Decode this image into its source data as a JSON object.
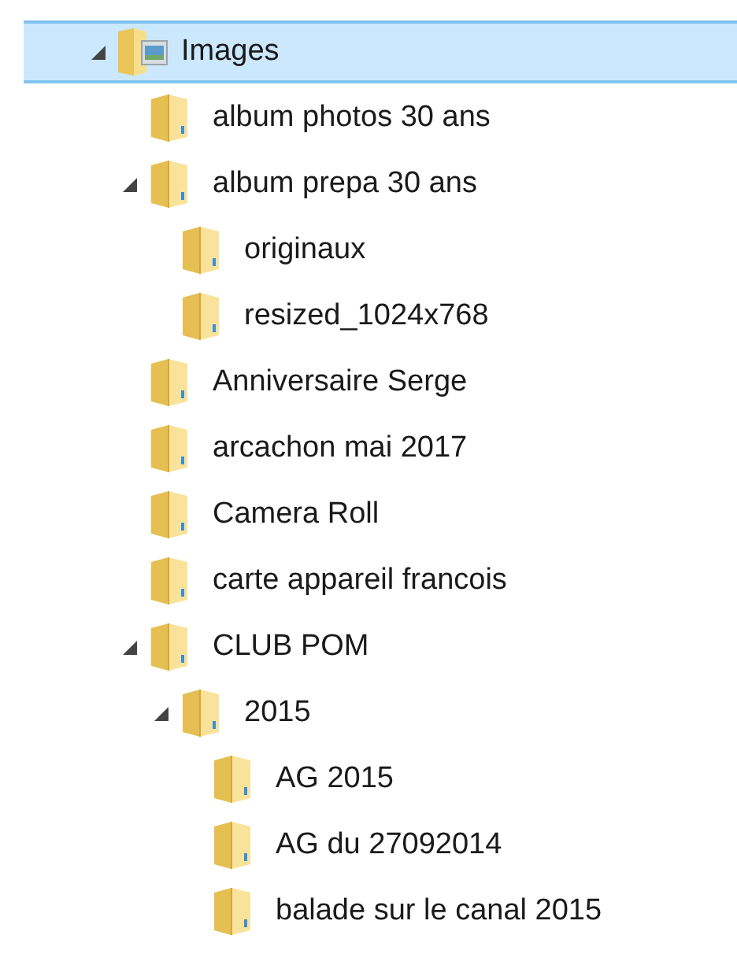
{
  "tree": [
    {
      "label": "Images",
      "kind": "library",
      "selected": true,
      "expanded": true,
      "children": [
        {
          "label": "album photos 30 ans",
          "kind": "folder",
          "selected": false
        },
        {
          "label": "album prepa 30 ans",
          "kind": "folder",
          "selected": false,
          "expanded": true,
          "children": [
            {
              "label": "originaux",
              "kind": "folder",
              "selected": false
            },
            {
              "label": "resized_1024x768",
              "kind": "folder",
              "selected": false
            }
          ]
        },
        {
          "label": "Anniversaire Serge",
          "kind": "folder",
          "selected": false
        },
        {
          "label": "arcachon mai 2017",
          "kind": "folder",
          "selected": false
        },
        {
          "label": "Camera Roll",
          "kind": "folder",
          "selected": false
        },
        {
          "label": "carte appareil francois",
          "kind": "folder",
          "selected": false
        },
        {
          "label": "CLUB POM",
          "kind": "folder",
          "selected": false,
          "expanded": true,
          "children": [
            {
              "label": "2015",
              "kind": "folder",
              "selected": false,
              "expanded": true,
              "children": [
                {
                  "label": "AG 2015",
                  "kind": "folder",
                  "selected": false
                },
                {
                  "label": "AG du 27092014",
                  "kind": "folder",
                  "selected": false
                },
                {
                  "label": "balade sur le canal 2015",
                  "kind": "folder",
                  "selected": false
                }
              ]
            }
          ]
        }
      ]
    }
  ]
}
